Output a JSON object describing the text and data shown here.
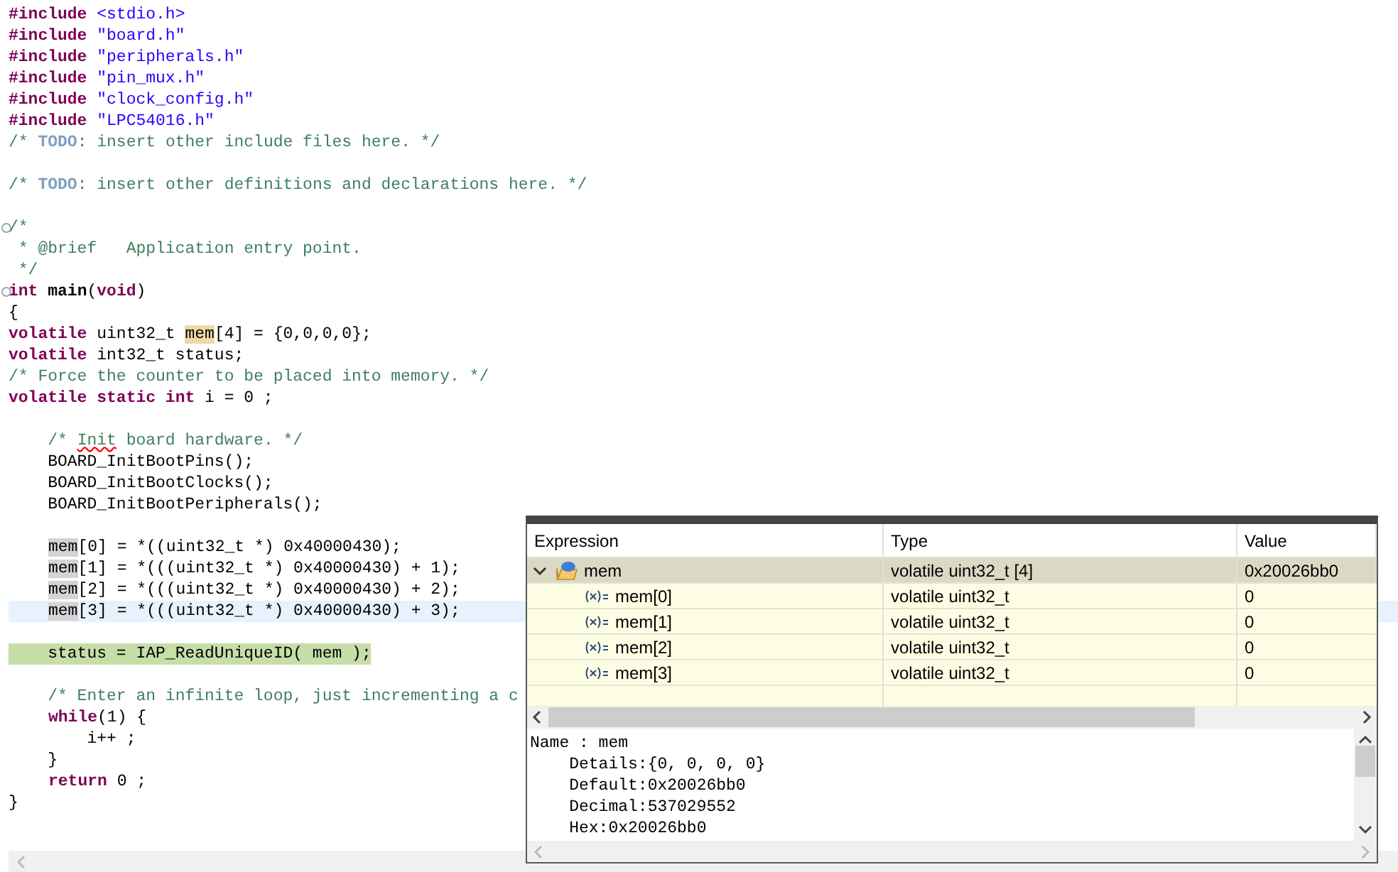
{
  "editor": {
    "lines": [
      {
        "kind": "normal",
        "tokens": [
          {
            "kind": "directive",
            "text": "#include"
          },
          {
            "kind": "string",
            "text": " <stdio.h>"
          }
        ]
      },
      {
        "kind": "normal",
        "tokens": [
          {
            "kind": "directive",
            "text": "#include"
          },
          {
            "kind": "string",
            "text": " \"board.h\""
          }
        ]
      },
      {
        "kind": "normal",
        "tokens": [
          {
            "kind": "directive",
            "text": "#include"
          },
          {
            "kind": "string",
            "text": " \"peripherals.h\""
          }
        ]
      },
      {
        "kind": "normal",
        "tokens": [
          {
            "kind": "directive",
            "text": "#include"
          },
          {
            "kind": "string",
            "text": " \"pin_mux.h\""
          }
        ]
      },
      {
        "kind": "normal",
        "tokens": [
          {
            "kind": "directive",
            "text": "#include"
          },
          {
            "kind": "string",
            "text": " \"clock_config.h\""
          }
        ]
      },
      {
        "kind": "normal",
        "tokens": [
          {
            "kind": "directive",
            "text": "#include"
          },
          {
            "kind": "string",
            "text": " \"LPC54016.h\""
          }
        ]
      },
      {
        "kind": "normal",
        "tokens": [
          {
            "kind": "comment",
            "text": "/* "
          },
          {
            "kind": "todo",
            "text": "TODO"
          },
          {
            "kind": "comment",
            "text": ": insert other include files here. */"
          }
        ]
      },
      {
        "kind": "normal"
      },
      {
        "kind": "normal",
        "tokens": [
          {
            "kind": "comment",
            "text": "/* "
          },
          {
            "kind": "todo",
            "text": "TODO"
          },
          {
            "kind": "comment",
            "text": ": insert other definitions and declarations here. */"
          }
        ]
      },
      {
        "kind": "normal"
      },
      {
        "kind": "fold",
        "tokens": [
          {
            "kind": "comment",
            "text": "/*"
          }
        ]
      },
      {
        "kind": "normal",
        "tokens": [
          {
            "kind": "comment",
            "text": " * @brief   Application entry point."
          }
        ]
      },
      {
        "kind": "normal",
        "tokens": [
          {
            "kind": "comment",
            "text": " */"
          }
        ]
      },
      {
        "kind": "fold",
        "tokens": [
          {
            "kind": "keyword",
            "text": "int"
          },
          {
            "kind": "function",
            "text": " main"
          },
          {
            "kind": "plain",
            "text": "("
          },
          {
            "kind": "keyword",
            "text": "void"
          },
          {
            "kind": "plain",
            "text": ")"
          }
        ]
      },
      {
        "kind": "normal",
        "tokens": [
          {
            "kind": "plain",
            "text": "{"
          }
        ]
      },
      {
        "kind": "normal",
        "tokens": [
          {
            "kind": "keyword",
            "text": "volatile"
          },
          {
            "kind": "plain",
            "text": " uint32_t "
          },
          {
            "kind": "selected",
            "text": "mem"
          },
          {
            "kind": "plain",
            "text": "[4] = {0,0,0,0};"
          }
        ]
      },
      {
        "kind": "normal",
        "tokens": [
          {
            "kind": "keyword",
            "text": "volatile"
          },
          {
            "kind": "plain",
            "text": " int32_t status;"
          }
        ]
      },
      {
        "kind": "normal",
        "tokens": [
          {
            "kind": "comment",
            "text": "/* Force the counter to be placed into memory. */"
          }
        ]
      },
      {
        "kind": "normal",
        "tokens": [
          {
            "kind": "keyword",
            "text": "volatile static int"
          },
          {
            "kind": "plain",
            "text": " i = 0 ;"
          }
        ]
      },
      {
        "kind": "normal"
      },
      {
        "kind": "normal",
        "tokens": [
          {
            "kind": "comment",
            "text": "    /* "
          },
          {
            "kind": "misspelled",
            "text": "Init"
          },
          {
            "kind": "comment",
            "text": " board hardware. */"
          }
        ]
      },
      {
        "kind": "normal",
        "tokens": [
          {
            "kind": "plain",
            "text": "    BOARD_InitBootPins();"
          }
        ]
      },
      {
        "kind": "normal",
        "tokens": [
          {
            "kind": "plain",
            "text": "    BOARD_InitBootClocks();"
          }
        ]
      },
      {
        "kind": "normal",
        "tokens": [
          {
            "kind": "plain",
            "text": "    BOARD_InitBootPeripherals();"
          }
        ]
      },
      {
        "kind": "normal"
      },
      {
        "kind": "normal",
        "indent": true,
        "tokens": [
          {
            "kind": "occurrence",
            "text": "mem"
          },
          {
            "kind": "plain",
            "text": "[0] = *((uint32_t *) 0x40000430);"
          }
        ]
      },
      {
        "kind": "normal",
        "indent": true,
        "tokens": [
          {
            "kind": "occurrence",
            "text": "mem"
          },
          {
            "kind": "plain",
            "text": "[1] = *(((uint32_t *) 0x40000430) + 1);"
          }
        ]
      },
      {
        "kind": "normal",
        "indent": true,
        "tokens": [
          {
            "kind": "occurrence",
            "text": "mem"
          },
          {
            "kind": "plain",
            "text": "[2] = *(((uint32_t *) 0x40000430) + 2);"
          }
        ]
      },
      {
        "kind": "current",
        "indent": true,
        "tokens": [
          {
            "kind": "occurrence",
            "text": "mem"
          },
          {
            "kind": "plain",
            "text": "[3] = *(((uint32_t *) 0x40000430) + 3);"
          }
        ]
      },
      {
        "kind": "normal"
      },
      {
        "kind": "execution",
        "tokens": [
          {
            "kind": "plain",
            "text": "    status = IAP_ReadUniqueID( mem );"
          }
        ]
      },
      {
        "kind": "normal"
      },
      {
        "kind": "normal",
        "tokens": [
          {
            "kind": "comment",
            "text": "    /* Enter an infinite loop, just incrementing a c"
          }
        ]
      },
      {
        "kind": "normal",
        "indent": true,
        "tokens": [
          {
            "kind": "keyword",
            "text": "while"
          },
          {
            "kind": "plain",
            "text": "(1) {"
          }
        ]
      },
      {
        "kind": "normal",
        "tokens": [
          {
            "kind": "plain",
            "text": "        i++ ;"
          }
        ]
      },
      {
        "kind": "normal",
        "tokens": [
          {
            "kind": "plain",
            "text": "    }"
          }
        ]
      },
      {
        "kind": "normal",
        "indent": true,
        "tokens": [
          {
            "kind": "keyword",
            "text": "return"
          },
          {
            "kind": "plain",
            "text": " 0 ;"
          }
        ]
      },
      {
        "kind": "normal",
        "tokens": [
          {
            "kind": "plain",
            "text": "}"
          }
        ]
      }
    ]
  },
  "hover": {
    "columns": [
      "Expression",
      "Type",
      "Value"
    ],
    "rows": [
      {
        "expression": "mem",
        "type": "volatile uint32_t [4]",
        "value": "0x20026bb0",
        "expanded": true,
        "selected": true,
        "children": [
          {
            "expression": "mem[0]",
            "type": "volatile uint32_t",
            "value": "0",
            "selected": false
          },
          {
            "expression": "mem[1]",
            "type": "volatile uint32_t",
            "value": "0",
            "selected": false
          },
          {
            "expression": "mem[2]",
            "type": "volatile uint32_t",
            "value": "0",
            "selected": false
          },
          {
            "expression": "mem[3]",
            "type": "volatile uint32_t",
            "value": "0",
            "selected": false
          }
        ]
      }
    ],
    "details": [
      "Name : mem",
      "    Details:{0, 0, 0, 0}",
      "    Default:0x20026bb0",
      "    Decimal:537029552",
      "    Hex:0x20026bb0"
    ]
  }
}
